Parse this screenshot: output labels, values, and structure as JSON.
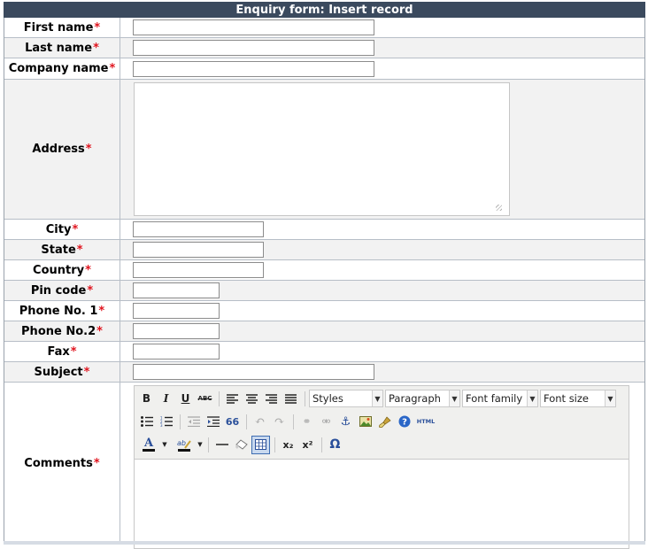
{
  "form": {
    "title": "Enquiry form: Insert record",
    "required_marker": "*",
    "fields": {
      "first_name": "First name",
      "last_name": "Last name",
      "company_name": "Company name",
      "address": "Address",
      "city": "City",
      "state": "State",
      "country": "Country",
      "pin_code": "Pin code",
      "phone1": "Phone No. 1",
      "phone2": "Phone No.2",
      "fax": "Fax",
      "subject": "Subject",
      "comments": "Comments"
    }
  },
  "editor": {
    "buttons": {
      "bold": "B",
      "italic": "I",
      "underline": "U",
      "strike": "ABC",
      "quote": "66",
      "html": "HTML",
      "omega": "Ω",
      "subscript": "x₂",
      "superscript": "x²"
    },
    "dropdowns": {
      "styles": "Styles",
      "paragraph": "Paragraph",
      "font_family": "Font family",
      "font_size": "Font size"
    }
  },
  "colors": {
    "title_bg": "#3b4a5e",
    "required": "#e0141e",
    "alt_row": "#f2f2f2"
  }
}
